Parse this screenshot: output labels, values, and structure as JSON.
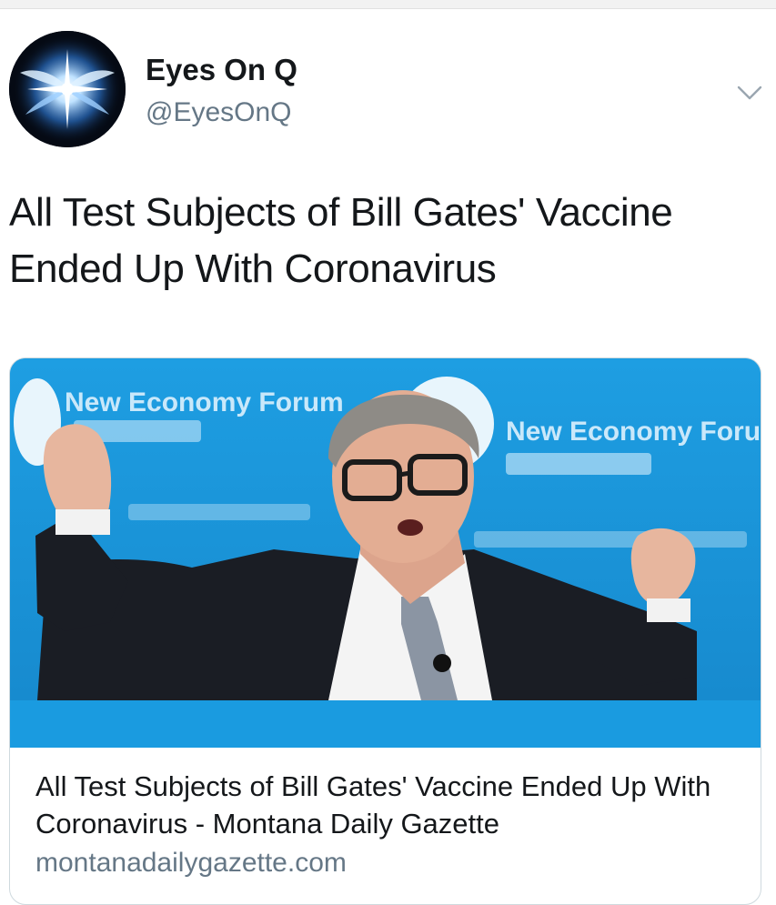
{
  "tweet": {
    "author_name": "Eyes On Q",
    "author_handle": "@EyesOnQ",
    "text": "All Test Subjects of Bill Gates' Vaccine Ended Up With Coronavirus",
    "menu_icon": "chevron-down-icon",
    "avatar_icon": "glowing-wings-icon"
  },
  "card": {
    "backdrop_text_left": "New Economy Forum",
    "backdrop_text_right": "New Economy Forum",
    "title": "All Test Subjects of Bill Gates' Vaccine Ended Up With Coronavirus - Montana Daily Gazette",
    "domain": "montanadailygazette.com"
  },
  "colors": {
    "backdrop_blue": "#1a98dc",
    "handle_gray": "#657786",
    "text_dark": "#14171a"
  }
}
